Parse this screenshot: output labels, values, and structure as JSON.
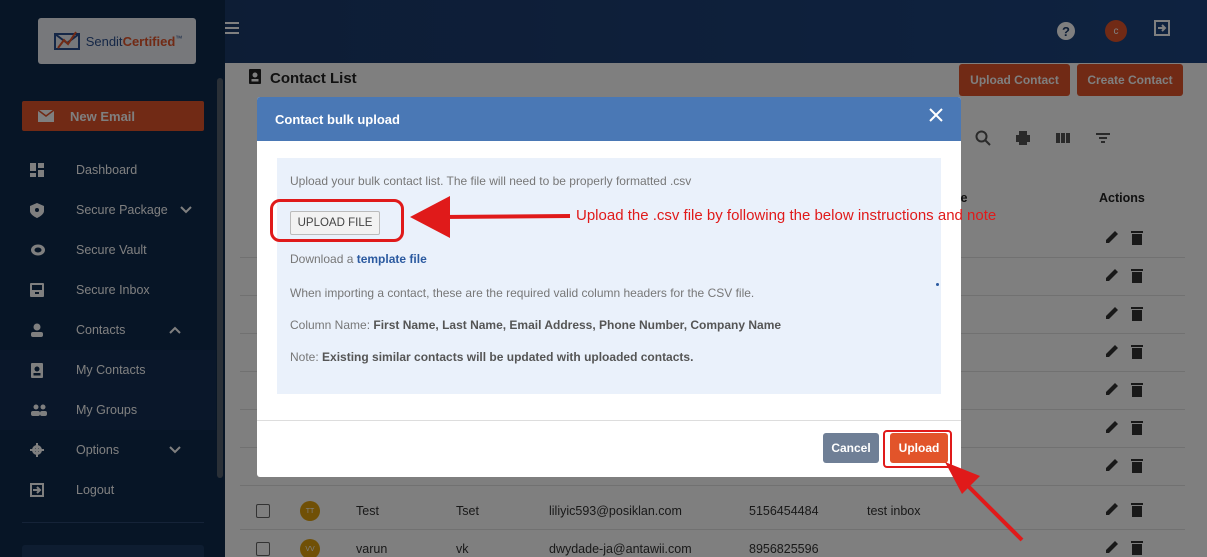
{
  "brand": {
    "logo_plain": "Sendit",
    "logo_bold": "Certified",
    "logo_tm": "™"
  },
  "sidebar": {
    "new_email": "New Email",
    "items": [
      {
        "label": "Dashboard",
        "icon": "dashboard-icon"
      },
      {
        "label": "Secure Package",
        "icon": "shield-icon",
        "arrow": "chevron-down"
      },
      {
        "label": "Secure Vault",
        "icon": "cloud-icon"
      },
      {
        "label": "Secure Inbox",
        "icon": "inbox-icon"
      },
      {
        "label": "Contacts",
        "icon": "person-icon",
        "arrow": "chevron-up"
      },
      {
        "label": "My Contacts",
        "icon": "contact-book-icon"
      },
      {
        "label": "My Groups",
        "icon": "group-icon"
      },
      {
        "label": "Options",
        "icon": "gear-icon",
        "arrow": "chevron-down"
      },
      {
        "label": "Logout",
        "icon": "logout-icon"
      }
    ]
  },
  "header": {
    "help": "?",
    "avatar": "c"
  },
  "page": {
    "title": "Contact List",
    "upload_contact": "Upload Contact",
    "create_contact": "Create Contact",
    "col_name_partial": "ıe",
    "col_actions": "Actions"
  },
  "rows": [
    {
      "initials": "TT",
      "first": "Test",
      "last": "Tset",
      "email": "liliyic593@posiklan.com",
      "phone": "5156454484",
      "company": "test inbox"
    },
    {
      "initials": "VV",
      "first": "varun",
      "last": "vk",
      "email": "dwydade-ja@antawii.com",
      "phone": "8956825596",
      "company": ""
    }
  ],
  "modal": {
    "title": "Contact bulk upload",
    "intro": "Upload your bulk contact list. The file will need to be properly formatted .csv",
    "upload_file": "UPLOAD FILE",
    "download_prefix": "Download a ",
    "template_link": "template file",
    "required_headers": "When importing a contact, these are the required valid column headers for the CSV file.",
    "column_label": "Column Name: ",
    "column_names": "First Name, Last Name, Email Address, Phone Number, Company Name",
    "note_label": "Note: ",
    "note_text": "Existing similar contacts will be updated with uploaded contacts.",
    "cancel": "Cancel",
    "upload": "Upload"
  },
  "annotation": {
    "text": "Upload the .csv file by following the below instructions and note",
    "color": "#e01a1a"
  },
  "colors": {
    "accent": "#e2542a",
    "sidebar": "#0f2a4d",
    "modal_header": "#4a78b5"
  }
}
